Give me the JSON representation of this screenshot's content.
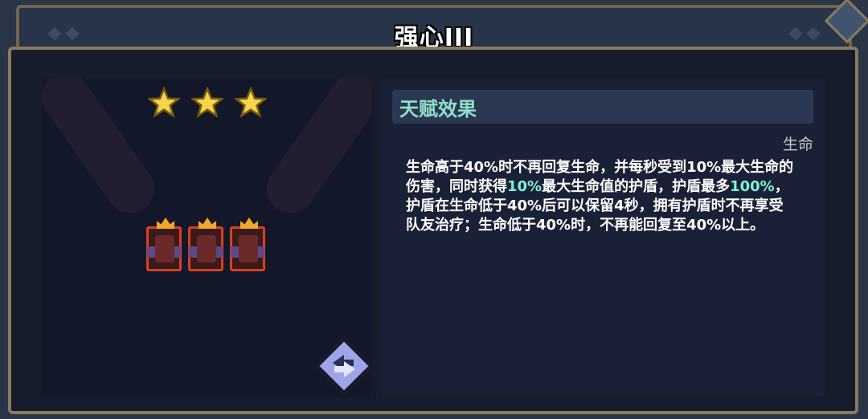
{
  "title": "强心III",
  "stars": {
    "count": 3,
    "max": 3
  },
  "units": [
    {
      "name": "red-demon-unit"
    },
    {
      "name": "red-demon-unit"
    },
    {
      "name": "red-demon-unit"
    }
  ],
  "effect_panel": {
    "header": "天赋效果",
    "tag": "生命",
    "description": {
      "s1": "生命高于40%时不再回复生命，并每秒受到10%最大生命的伤害，同时获得",
      "h1": "10%",
      "s2": "最大生命值的护盾，护盾最多",
      "h2": "100%",
      "s3": "，护盾在生命低于40%后可以保留4秒，拥有护盾时不再享受队友治疗；生命低于40%时，不再能回复至40%以上。"
    }
  },
  "colors": {
    "highlight": "#7ef0d8",
    "header_text": "#8fe0c8",
    "unit_border": "#d8401e",
    "star": "#f5d54a"
  },
  "icons": {
    "swap": "swap-arrows-icon",
    "star": "star-icon"
  }
}
